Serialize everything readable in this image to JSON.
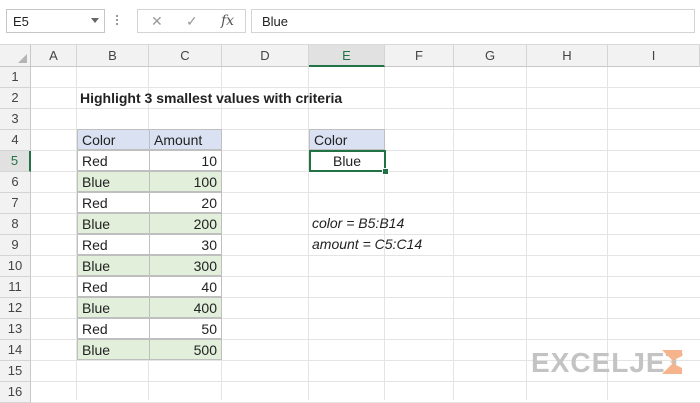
{
  "formula_bar": {
    "name_box": "E5",
    "cancel_icon": "✕",
    "enter_icon": "✓",
    "fx_icon": "fx",
    "formula": "Blue"
  },
  "columns": [
    "A",
    "B",
    "C",
    "D",
    "E",
    "F",
    "G",
    "H",
    "I"
  ],
  "selected_column": "E",
  "rows": [
    "1",
    "2",
    "3",
    "4",
    "5",
    "6",
    "7",
    "8",
    "9",
    "10",
    "11",
    "12",
    "13",
    "14",
    "15",
    "16"
  ],
  "selected_row": "5",
  "sheet": {
    "title": "Highlight 3 smallest values with criteria",
    "table_headers": [
      "Color",
      "Amount"
    ],
    "table_rows": [
      {
        "color": "Red",
        "amount": "10"
      },
      {
        "color": "Blue",
        "amount": "100"
      },
      {
        "color": "Red",
        "amount": "20"
      },
      {
        "color": "Blue",
        "amount": "200"
      },
      {
        "color": "Red",
        "amount": "30"
      },
      {
        "color": "Blue",
        "amount": "300"
      },
      {
        "color": "Red",
        "amount": "40"
      },
      {
        "color": "Blue",
        "amount": "400"
      },
      {
        "color": "Red",
        "amount": "50"
      },
      {
        "color": "Blue",
        "amount": "500"
      }
    ],
    "criteria_header": "Color",
    "criteria_value": "Blue",
    "note_color": "color = B5:B14",
    "note_amount": "amount = C5:C14"
  },
  "brand": {
    "logo_text": "EXCELJET",
    "logo_color": "#c3c3c3",
    "accent": "#f6b48c"
  },
  "colors": {
    "header_fill": "#d9e1f2",
    "highlight_fill": "#e2efda",
    "selection": "#217346"
  }
}
